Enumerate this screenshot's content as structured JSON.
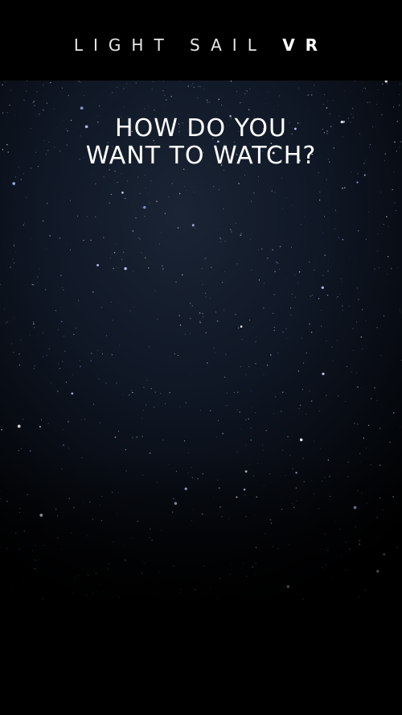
{
  "app": {
    "brand_light": "LIGHT SAIL",
    "brand_bold": "VR"
  },
  "main": {
    "headline_line1": "HOW DO YOU",
    "headline_line2": "WANT TO WATCH?"
  },
  "colors": {
    "background": "#000000",
    "sky_center": "#1a2434",
    "text": "#ffffff"
  }
}
